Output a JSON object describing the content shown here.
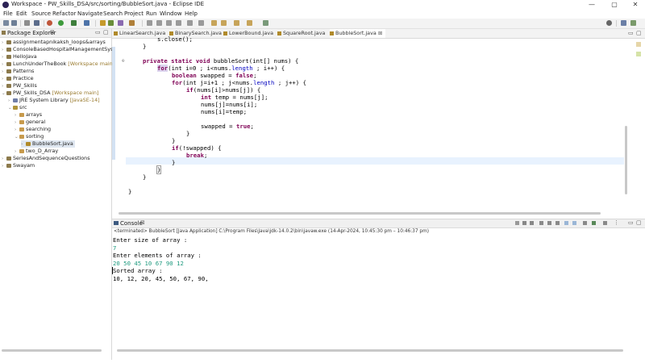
{
  "window": {
    "title": "Workspace - PW_Skills_DSA/src/sorting/BubbleSort.java - Eclipse IDE",
    "minimize": "—",
    "maximize": "▢",
    "close": "✕"
  },
  "menu": [
    "File",
    "Edit",
    "Source",
    "Refactor",
    "Navigate",
    "Search",
    "Project",
    "Run",
    "Window",
    "Help"
  ],
  "explorer": {
    "title": "Package Explorer",
    "items": [
      {
        "label": "assignmentapnikaksh_loops&arrays",
        "decor": ""
      },
      {
        "label": "ConsoleBasedHospitalManagementSystem",
        "decor": ""
      },
      {
        "label": "HelloJava",
        "decor": ""
      },
      {
        "label": "LunchUnderTheBook",
        "decor": "[Workspace main]"
      },
      {
        "label": "Patterns",
        "decor": ""
      },
      {
        "label": "Practice",
        "decor": ""
      },
      {
        "label": "PW_Skills",
        "decor": ""
      },
      {
        "label": "PW_Skills_DSA",
        "decor": "[Workspace main]"
      },
      {
        "label": "JRE System Library",
        "decor": "[JavaSE-14]"
      },
      {
        "label": "src",
        "decor": ""
      },
      {
        "label": "arrays",
        "decor": ""
      },
      {
        "label": "general",
        "decor": ""
      },
      {
        "label": "searching",
        "decor": ""
      },
      {
        "label": "sorting",
        "decor": ""
      },
      {
        "label": "BubbleSort.java",
        "decor": ""
      },
      {
        "label": "two_D_Array",
        "decor": ""
      },
      {
        "label": "SeriesAndSequenceQuestions",
        "decor": ""
      },
      {
        "label": "Swayam",
        "decor": ""
      }
    ]
  },
  "tabs": [
    "LinearSearch.java",
    "BinarySearch.java",
    "LowerBound.java",
    "SquareRoot.java",
    "BubbleSort.java"
  ],
  "code": {
    "l0": "s.close();",
    "l1": "}",
    "sig_mod": "private static void",
    "sig_rest": " bubbleSort(int[] nums) {",
    "for1_kw": "for",
    "for1_a": "(int i=0 ; i<nums.",
    "for1_len": "length",
    "for1_b": " ; i++) {",
    "bool_kw": "boolean",
    "bool_rest": " swapped = ",
    "bool_false": "false",
    "bool_end": ";",
    "for2_kw": "for",
    "for2_a": "(int j=i+1 ; j<nums.",
    "for2_len": "length",
    "for2_b": " ; j++) {",
    "if1_kw": "if",
    "if1_rest": "(nums[i]>nums[j]) {",
    "temp_kw": "int",
    "temp_rest": " temp = nums[j];",
    "assign1": "nums[j]=nums[i];",
    "assign2": "nums[i]=temp;",
    "sw_a": "swapped = ",
    "sw_true": "true",
    "sw_end": ";",
    "close_a": "}",
    "close_b": "}",
    "if2_kw": "if",
    "if2_rest": "(!swapped) {",
    "break_kw": "break",
    "break_end": ";",
    "close_c": "}",
    "close_d": "}",
    "close_e": "}",
    "close_f": "}"
  },
  "console": {
    "title": "Console",
    "status": "<terminated> BubbleSort [Java Application] C:\\Program Files\\Java\\jdk-14.0.2\\bin\\javaw.exe  (14-Apr-2024, 10:45:30 pm – 10:46:37 pm)",
    "lines": [
      {
        "text": "Enter size of array :",
        "input": false
      },
      {
        "text": "7",
        "input": true
      },
      {
        "text": "Enter elements of array :",
        "input": false
      },
      {
        "text": "20 50 45 10 67 90 12",
        "input": true
      },
      {
        "text": "Sorted array :",
        "input": false
      },
      {
        "text": "10, 12, 20, 45, 50, 67, 90,",
        "input": false
      }
    ]
  },
  "colors": {
    "keyword": "#7f0055",
    "field": "#0000c0",
    "console_input": "#1f9a7f",
    "current_line": "#e8f2fe"
  }
}
